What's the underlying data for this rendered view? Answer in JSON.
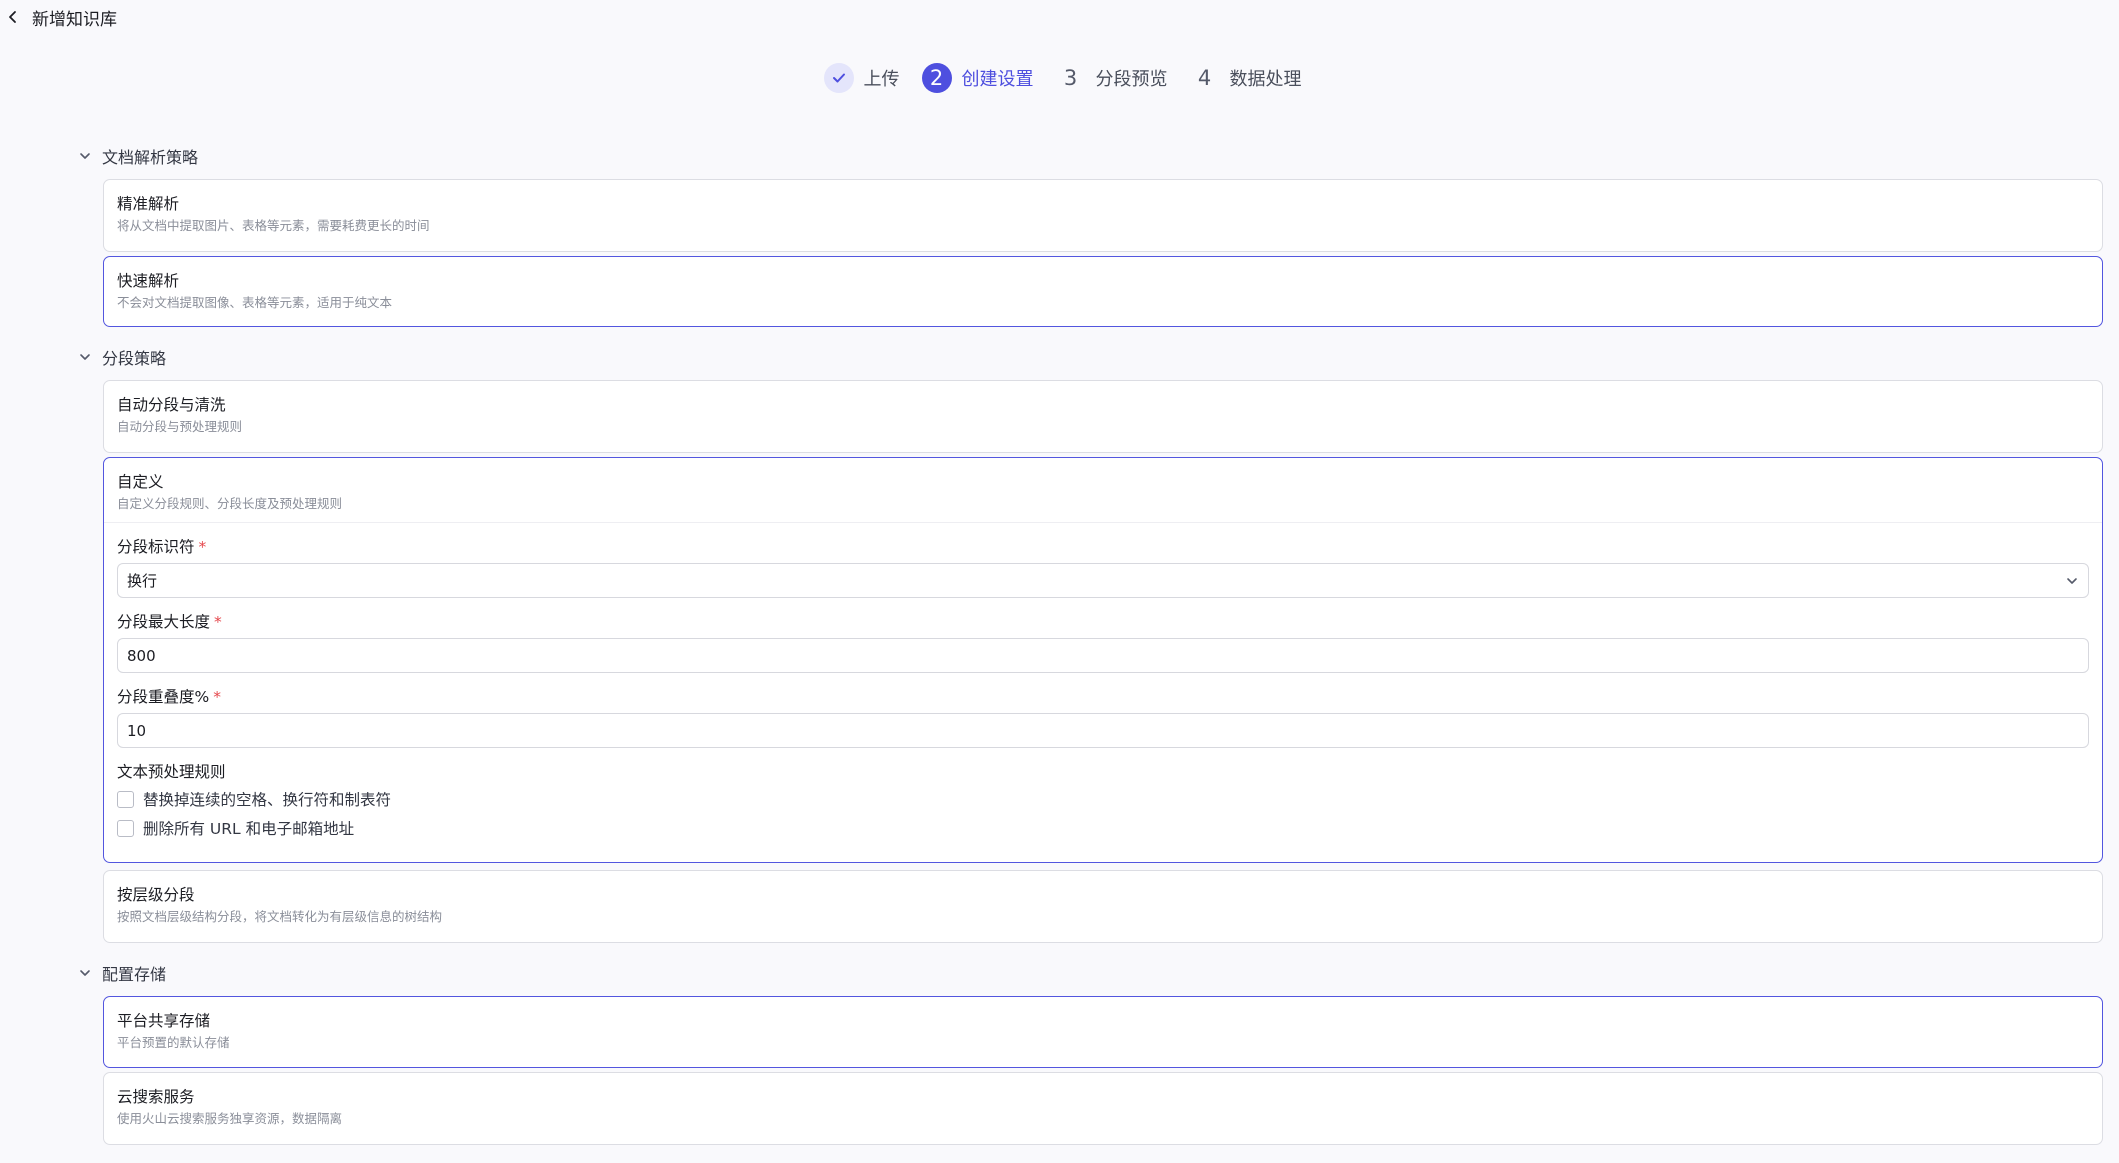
{
  "header": {
    "title": "新增知识库"
  },
  "steps": [
    {
      "number": "✓",
      "label": "上传",
      "state": "done"
    },
    {
      "number": "2",
      "label": "创建设置",
      "state": "active"
    },
    {
      "number": "3",
      "label": "分段预览",
      "state": "pending"
    },
    {
      "number": "4",
      "label": "数据处理",
      "state": "pending"
    }
  ],
  "sections": {
    "parse": {
      "title": "文档解析策略",
      "options": [
        {
          "title": "精准解析",
          "desc": "将从文档中提取图片、表格等元素，需要耗费更长的时间",
          "selected": false
        },
        {
          "title": "快速解析",
          "desc": "不会对文档提取图像、表格等元素，适用于纯文本",
          "selected": true
        }
      ]
    },
    "segment": {
      "title": "分段策略",
      "auto": {
        "title": "自动分段与清洗",
        "desc": "自动分段与预处理规则"
      },
      "custom": {
        "title": "自定义",
        "desc": "自定义分段规则、分段长度及预处理规则",
        "identifier": {
          "label": "分段标识符",
          "required": "*",
          "value": "换行"
        },
        "max_length": {
          "label": "分段最大长度",
          "required": "*",
          "value": "800"
        },
        "overlap": {
          "label": "分段重叠度%",
          "required": "*",
          "value": "10"
        },
        "preprocess": {
          "label": "文本预处理规则",
          "rules": [
            {
              "label": "替换掉连续的空格、换行符和制表符",
              "checked": false
            },
            {
              "label": "删除所有 URL 和电子邮箱地址",
              "checked": false
            }
          ]
        }
      },
      "hierarchy": {
        "title": "按层级分段",
        "desc": "按照文档层级结构分段，将文档转化为有层级信息的树结构"
      }
    },
    "storage": {
      "title": "配置存储",
      "options": [
        {
          "title": "平台共享存储",
          "desc": "平台预置的默认存储",
          "selected": true
        },
        {
          "title": "云搜索服务",
          "desc": "使用火山云搜索服务独享资源，数据隔离",
          "selected": false
        }
      ]
    }
  },
  "colors": {
    "accent": "#4e4fdf",
    "border": "#dcdde3",
    "required": "#e5484d"
  },
  "icons": {
    "back": "chevron-left-icon",
    "collapse": "chevron-down-icon",
    "check": "check-icon"
  }
}
